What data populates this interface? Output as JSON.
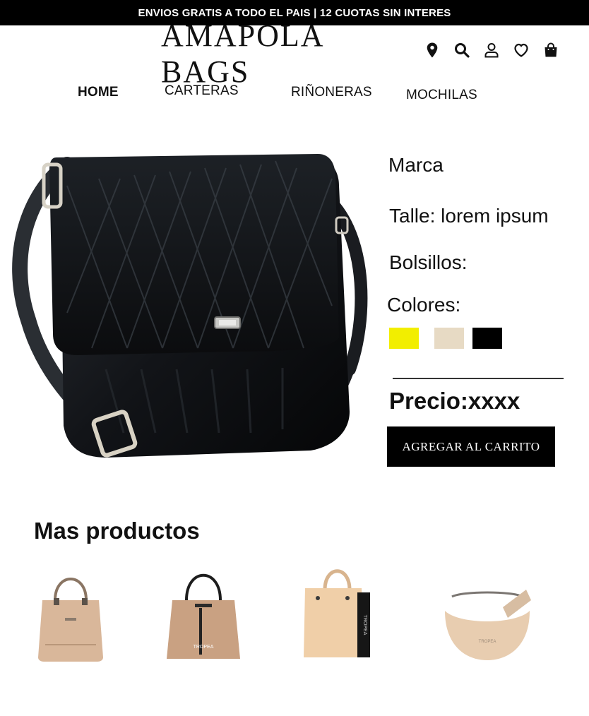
{
  "topbar": {
    "text": "ENVIOS GRATIS A TODO EL PAIS | 12 CUOTAS SIN INTERES"
  },
  "header": {
    "logo": "AMAPOLA BAGS",
    "icons": [
      "location-icon",
      "search-icon",
      "user-icon",
      "heart-icon",
      "shopping-bag-icon"
    ]
  },
  "nav": {
    "home": "HOME",
    "carteras": "CARTERAS",
    "rinoneras": "RIÑONERAS",
    "mochilas": "MOCHILAS"
  },
  "product": {
    "brand": "Marca",
    "talle": "Talle: lorem ipsum",
    "bolsillos": "Bolsillos:",
    "colores_label": "Colores:",
    "colors": [
      "#f2ee00",
      "#e7dac4",
      "#000000"
    ],
    "price": "Precio:xxxx",
    "add_to_cart": "AGREGAR AL CARRITO"
  },
  "more": {
    "title": "Mas productos"
  }
}
